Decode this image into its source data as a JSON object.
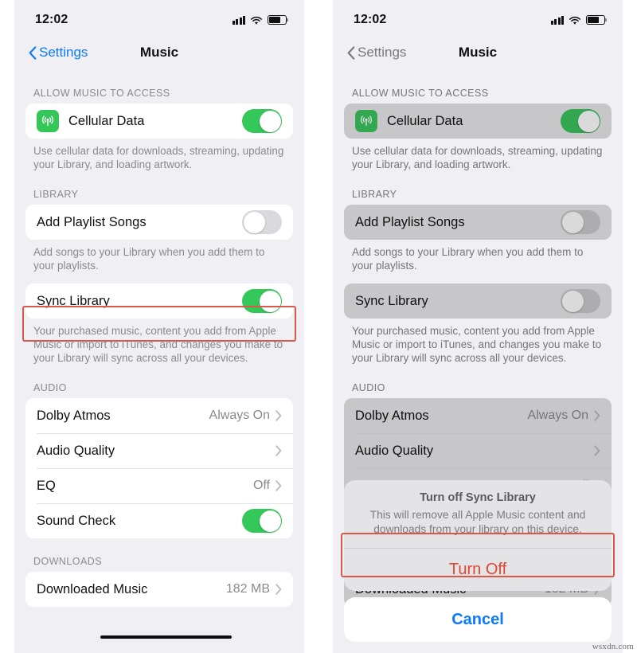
{
  "status_bar": {
    "time": "12:02",
    "signal_icon": "cellular-signal-icon",
    "wifi_icon": "wifi-icon",
    "battery_icon": "battery-icon"
  },
  "nav": {
    "back_label": "Settings",
    "title": "Music",
    "back_icon": "chevron-left-icon"
  },
  "sections": {
    "allow_access": {
      "header": "ALLOW MUSIC TO ACCESS",
      "row_label": "Cellular Data",
      "icon": "cellular-data-icon",
      "toggle_left": "on",
      "toggle_right": "on",
      "footnote": "Use cellular data for downloads, streaming, updating your Library, and loading artwork."
    },
    "library": {
      "header": "LIBRARY",
      "add_playlist_songs": {
        "label": "Add Playlist Songs",
        "toggle_left": "off",
        "toggle_right": "off",
        "footnote": "Add songs to your Library when you add them to your playlists."
      },
      "sync_library": {
        "label": "Sync Library",
        "toggle_left": "on",
        "toggle_right": "off",
        "footnote": "Your purchased music, content you add from Apple Music or import to iTunes, and changes you make to your Library will sync across all your devices."
      }
    },
    "audio": {
      "header": "AUDIO",
      "rows": [
        {
          "label": "Dolby Atmos",
          "value": "Always On",
          "accessory": "chevron"
        },
        {
          "label": "Audio Quality",
          "value": "",
          "accessory": "chevron"
        },
        {
          "label": "EQ",
          "value": "Off",
          "accessory": "chevron"
        },
        {
          "label": "Sound Check",
          "value": "",
          "accessory": "toggle-on"
        }
      ]
    },
    "downloads": {
      "header": "DOWNLOADS",
      "row_label": "Downloaded Music",
      "row_value": "182 MB",
      "accessory": "chevron"
    }
  },
  "alert": {
    "title": "Turn off Sync Library",
    "message": "This will remove all Apple Music content and downloads from your library on this device.",
    "destructive_label": "Turn Off",
    "cancel_label": "Cancel"
  },
  "annotations": {
    "highlight_color": "#d9584a",
    "left_highlight_target": "Sync Library",
    "right_highlight_target": "Turn Off"
  },
  "watermark": "wsxdn.com"
}
